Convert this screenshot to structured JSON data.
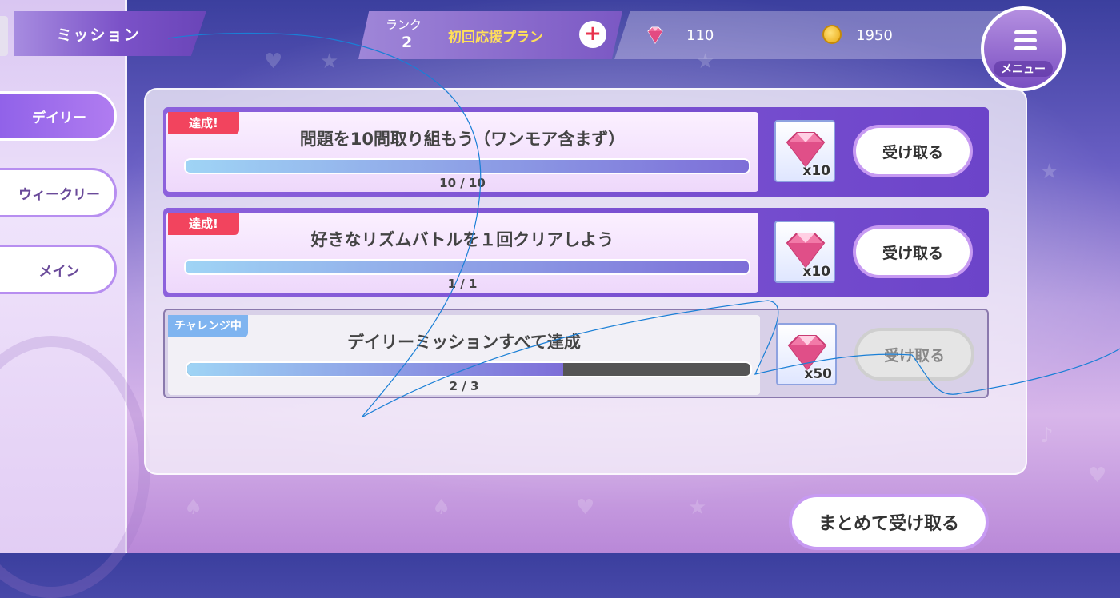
{
  "header": {
    "title": "ミッション"
  },
  "sidebar": {
    "tabs": [
      {
        "label": "デイリー",
        "active": true
      },
      {
        "label": "ウィークリー",
        "active": false
      },
      {
        "label": "メイン",
        "active": false
      }
    ]
  },
  "topbar": {
    "rank_label": "ランク",
    "rank_value": "2",
    "plan_label": "初回応援プラン",
    "plus_icon": "+",
    "gems": "110",
    "coins": "1950",
    "menu_label": "メニュー"
  },
  "missions": [
    {
      "status": "達成!",
      "status_type": "done",
      "title": "問題を10問取り組もう（ワンモア含まず）",
      "progress_text": "10 / 10",
      "progress": 1.0,
      "reward_qty": "x10",
      "claim_label": "受け取る",
      "claim_enabled": true
    },
    {
      "status": "達成!",
      "status_type": "done",
      "title": "好きなリズムバトルを１回クリアしよう",
      "progress_text": "1 / 1",
      "progress": 1.0,
      "reward_qty": "x10",
      "claim_label": "受け取る",
      "claim_enabled": true
    },
    {
      "status": "チャレンジ中",
      "status_type": "challenge",
      "title": "デイリーミッションすべて達成",
      "progress_text": "2 / 3",
      "progress": 0.667,
      "reward_qty": "x50",
      "claim_label": "受け取る",
      "claim_enabled": false
    }
  ],
  "footer": {
    "bulk_claim_label": "まとめて受け取る"
  },
  "icons": {
    "gem": "gem-icon",
    "coin": "coin-icon",
    "menu": "hamburger-icon"
  },
  "colors": {
    "accent": "#8d5fe8",
    "done_badge": "#f2445e",
    "challenge_badge": "#7fb4f0",
    "plan_text": "#ffe05a"
  }
}
